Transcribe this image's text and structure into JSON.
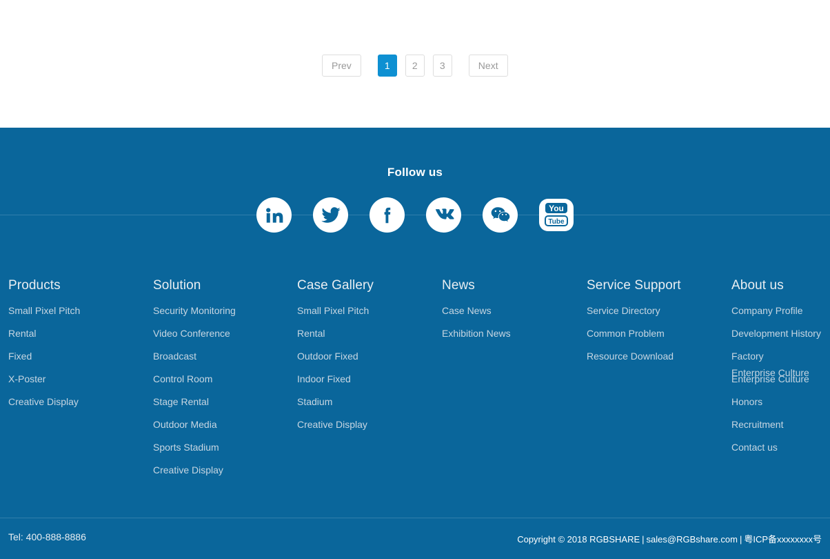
{
  "colors": {
    "footer_bg": "#0a669b",
    "accent_blue": "#0e90d2",
    "page_bg": "#ffffff",
    "heading": "#e9eef2",
    "link": "#c7d6e2"
  },
  "pagination": {
    "prev_label": "Prev",
    "next_label": "Next",
    "pages": [
      "1",
      "2",
      "3"
    ],
    "active_page": "1"
  },
  "follow": {
    "title": "Follow us",
    "socials": [
      {
        "name": "linkedin-icon",
        "label": "LinkedIn"
      },
      {
        "name": "twitter-icon",
        "label": "Twitter"
      },
      {
        "name": "facebook-icon",
        "label": "Facebook"
      },
      {
        "name": "vk-icon",
        "label": "VK"
      },
      {
        "name": "wechat-icon",
        "label": "WeChat"
      },
      {
        "name": "youtube-icon",
        "label": "YouTube"
      }
    ]
  },
  "columns": [
    {
      "heading": "Products",
      "links": [
        "Small Pixel Pitch",
        "Rental",
        "Fixed",
        "X-Poster",
        "Creative Display"
      ]
    },
    {
      "heading": "Solution",
      "links": [
        "Security Monitoring",
        "Video Conference",
        "Broadcast",
        "Control Room",
        "Stage Rental",
        "Outdoor Media",
        "Sports Stadium",
        "Creative Display"
      ]
    },
    {
      "heading": "Case Gallery",
      "links": [
        "Small Pixel Pitch",
        "Rental",
        "Outdoor Fixed",
        "Indoor Fixed",
        "Stadium",
        "Creative Display"
      ]
    },
    {
      "heading": "News",
      "links": [
        "Case News",
        "Exhibition News"
      ]
    },
    {
      "heading": "Service Support",
      "links": [
        "Service Directory",
        "Common Problem",
        "Resource Download"
      ]
    },
    {
      "heading": "About us",
      "links": [
        "Company Profile",
        "Development History",
        "Factory",
        "Enterprise Culture",
        "Honors",
        "Recruitment",
        "Contact us"
      ],
      "overlap_link": "Enterprise Culture",
      "overlap_index": 3
    }
  ],
  "bottom": {
    "tel": "Tel: 400-888-8886",
    "copyright": "Copyright © 2018 RGBSHARE",
    "email": "sales@RGBshare.com",
    "icp": "粤ICP备xxxxxxxx号",
    "separator": "|"
  }
}
